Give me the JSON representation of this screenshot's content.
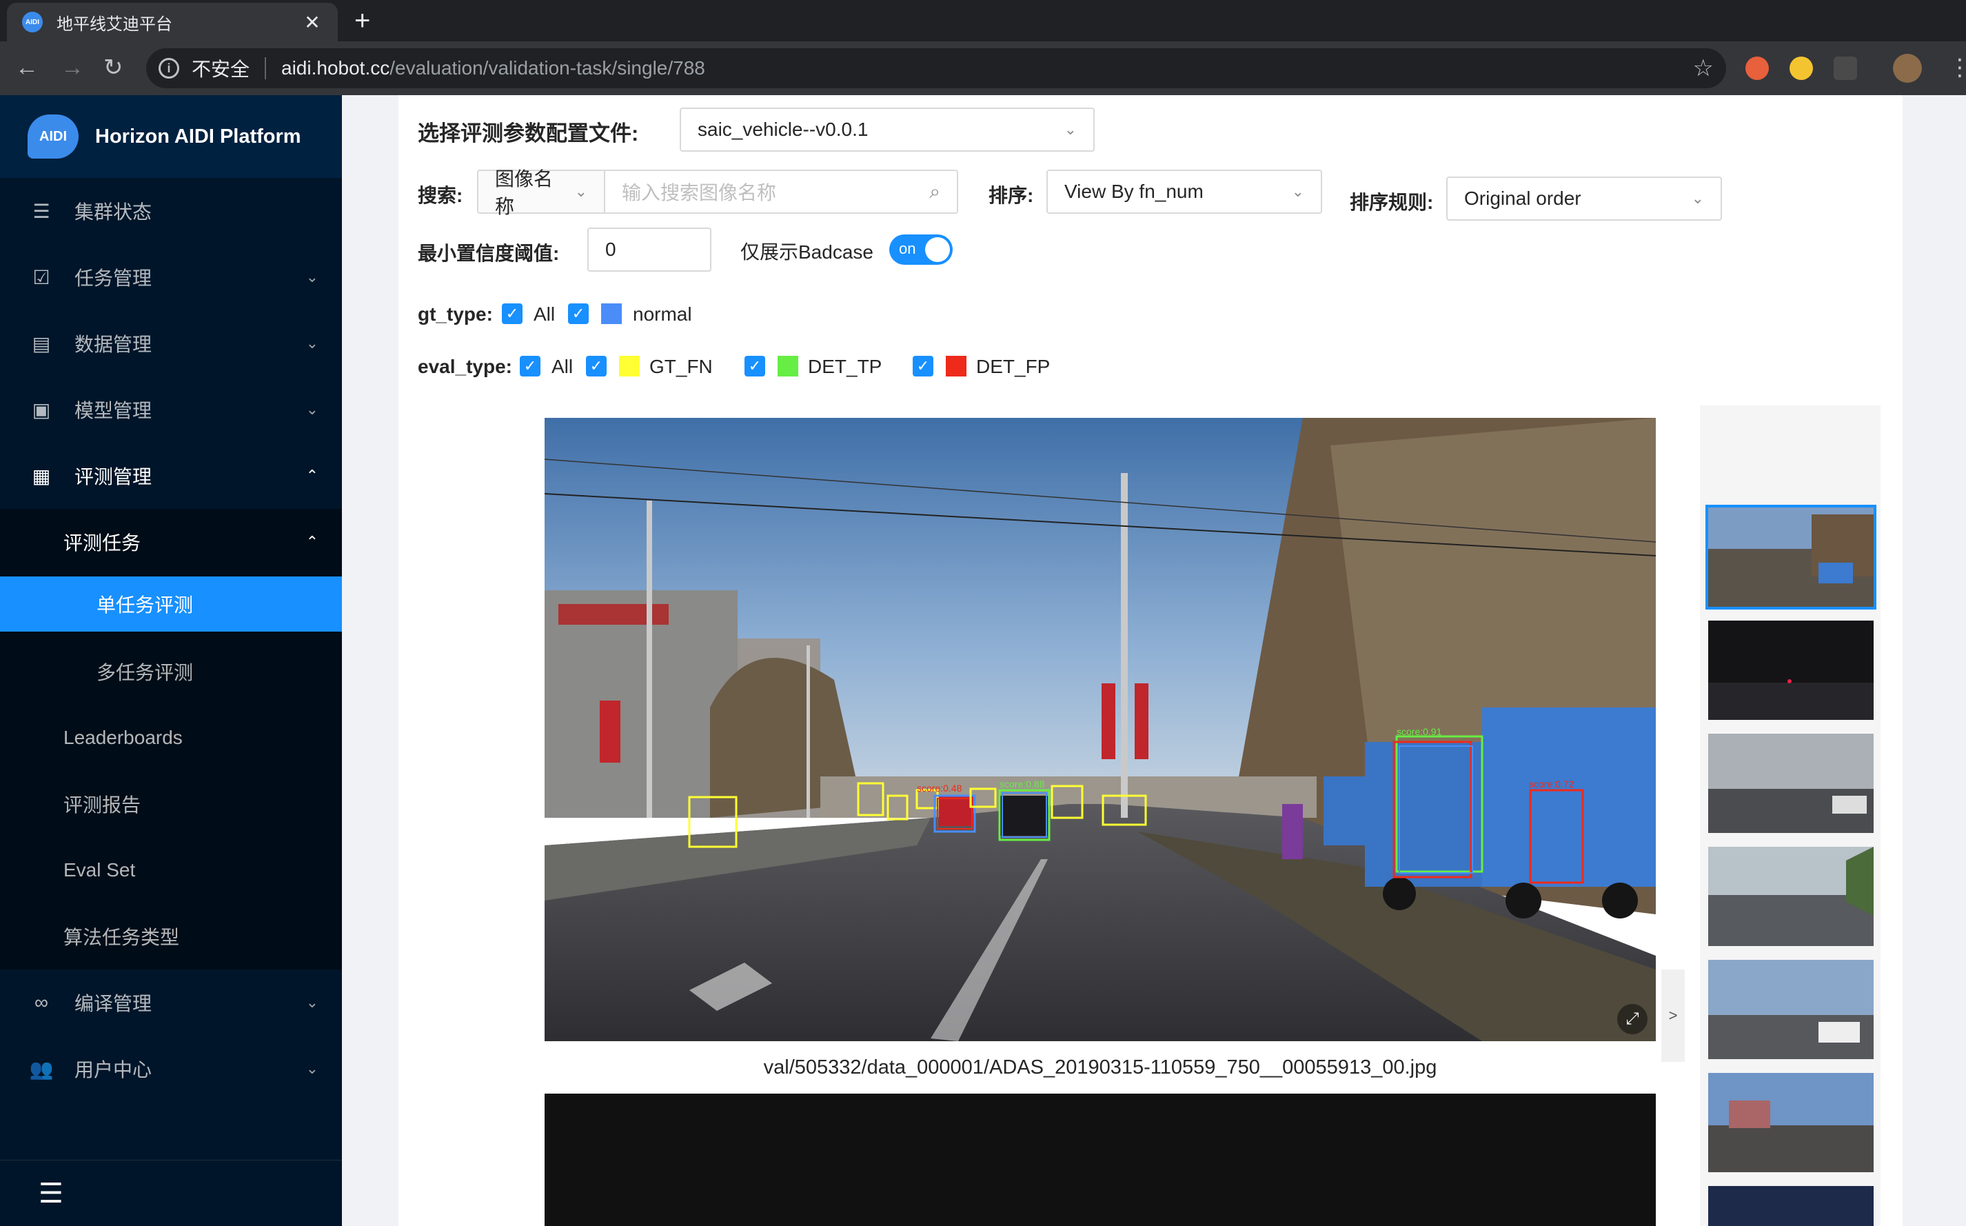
{
  "browser": {
    "tab_title": "地平线艾迪平台",
    "favicon_text": "AIDI",
    "close_glyph": "✕",
    "new_tab_glyph": "+",
    "not_secure": "不安全",
    "url_host": "aidi.hobot.cc",
    "url_path": "/evaluation/validation-task/single/788"
  },
  "sidebar": {
    "logo_mark": "AIDI",
    "logo_text": "Horizon AIDI Platform",
    "items": [
      {
        "label": "集群状态",
        "icon": "list-icon"
      },
      {
        "label": "任务管理",
        "icon": "checkbox-icon"
      },
      {
        "label": "数据管理",
        "icon": "database-icon"
      },
      {
        "label": "模型管理",
        "icon": "chip-icon"
      },
      {
        "label": "评测管理",
        "icon": "bar-chart-icon"
      },
      {
        "label": "评测任务"
      },
      {
        "label": "单任务评测"
      },
      {
        "label": "多任务评测"
      },
      {
        "label": "Leaderboards"
      },
      {
        "label": "评测报告"
      },
      {
        "label": "Eval Set"
      },
      {
        "label": "算法任务类型"
      },
      {
        "label": "编译管理",
        "icon": "infinity-icon"
      },
      {
        "label": "用户中心",
        "icon": "users-icon"
      }
    ]
  },
  "form": {
    "config_label": "选择评测参数配置文件:",
    "config_value": "saic_vehicle--v0.0.1",
    "search_label": "搜索:",
    "search_field": "图像名称",
    "search_placeholder": "输入搜索图像名称",
    "sort_label": "排序:",
    "sort_value": "View By fn_num",
    "sort_rule_label": "排序规则:",
    "sort_rule_value": "Original order",
    "min_conf_label": "最小置信度阈值:",
    "min_conf_value": "0",
    "badcase_label": "仅展示Badcase",
    "badcase_switch": "on",
    "gt_type_label": "gt_type:",
    "gt_all": "All",
    "gt_normal": "normal",
    "eval_type_label": "eval_type:",
    "eval_all": "All",
    "gt_fn": "GT_FN",
    "det_tp": "DET_TP",
    "det_fp": "DET_FP"
  },
  "colors": {
    "accent": "#1890ff",
    "normal": "#4a8df8",
    "gt_fn": "#ffff33",
    "det_tp": "#66ee44",
    "det_fp": "#ee2a1b"
  },
  "viewer": {
    "caption": "val/505332/data_000001/ADAS_20190315-110559_750__00055913_00.jpg",
    "next_glyph": ">",
    "expand_glyph": "⤢",
    "box_labels": [
      "score:0.48",
      "score:0.72",
      "score:0.91",
      "score:0.88"
    ]
  }
}
